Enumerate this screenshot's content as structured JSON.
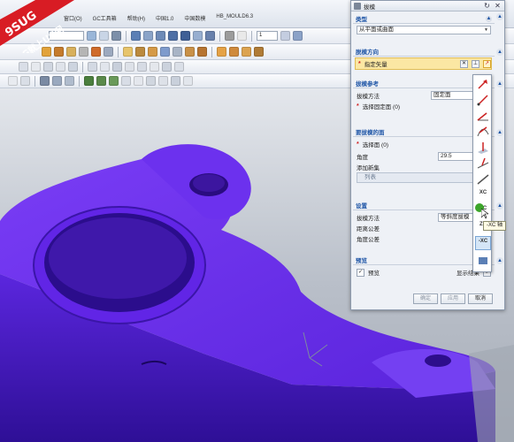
{
  "watermark": {
    "line1": "9SUG",
    "line2": "学UG就上UG网"
  },
  "menubar": {
    "items": [
      "窗口(O)",
      "GC工具箱",
      "帮助(H)",
      "中国1.0",
      "中国数模",
      "HB_MOULD6.3"
    ]
  },
  "toolbar": {
    "layer_value": "1"
  },
  "dialog": {
    "title": "拔模",
    "type_group": {
      "header": "类型",
      "selected_type": "从平面或曲面"
    },
    "draw_direction_group": {
      "header": "脱模方向",
      "specify_vector_label": "指定矢量"
    },
    "draft_reference_group": {
      "header": "拔模参考",
      "method_label": "拔模方法",
      "method_value": "固定面",
      "select_fixed_face_label": "选择固定面 (0)"
    },
    "faces_to_draft_group": {
      "header": "要拔模的面",
      "select_face_label": "选择面 (0)",
      "angle_label": "角度",
      "angle_value": "29.5",
      "angle_unit": "d",
      "add_new_set_label": "添加新集",
      "list_label": "列表"
    },
    "settings_group": {
      "header": "设置",
      "method_label": "拔模方法",
      "method_value": "等斜度拔模",
      "distance_tol_label": "距离公差",
      "distance_tol_value": "0.",
      "angle_tol_label": "角度公差",
      "angle_tol_value": "0."
    },
    "preview_group": {
      "header": "预览",
      "preview_checkbox_label": "预览",
      "preview_checked": true,
      "show_result_label": "显示结果"
    },
    "buttons": {
      "ok": "确定",
      "apply": "应用",
      "cancel": "取消"
    }
  },
  "vector_flyout": {
    "items": [
      "XC",
      "YC",
      "ZC",
      "-XC"
    ],
    "tooltip": "-XC 轴"
  },
  "colors": {
    "part": "#6a2ff0",
    "part_dark": "#3d1ab0",
    "accent_blue": "#1e55a6",
    "highlight_row": "#fbe7a3",
    "watermark_red": "#d81c24"
  }
}
